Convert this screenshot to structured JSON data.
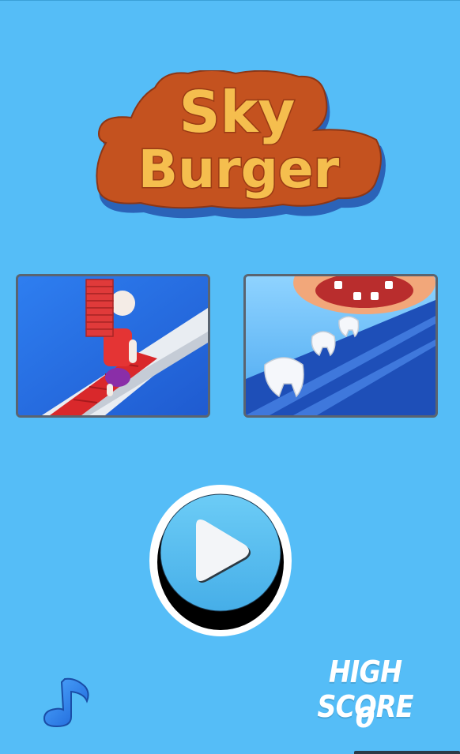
{
  "logo": {
    "line1": "Sky",
    "line2": "Burger"
  },
  "promos": [
    {
      "name": "stair-runner-game",
      "icon": "stack-runner-thumbnail"
    },
    {
      "name": "teeth-runner-game",
      "icon": "teeth-runner-thumbnail"
    }
  ],
  "play": {
    "icon": "play-icon"
  },
  "music": {
    "icon": "music-note-icon"
  },
  "high_score": {
    "label": "HIGH SCORE",
    "value": "0"
  },
  "colors": {
    "background": "#55bdf7",
    "logo_fill": "#f3b84a",
    "logo_outline": "#b84a1e",
    "logo_shadow": "#2b63b8",
    "play_face": "#57c0f2",
    "text": "#ffffff"
  }
}
